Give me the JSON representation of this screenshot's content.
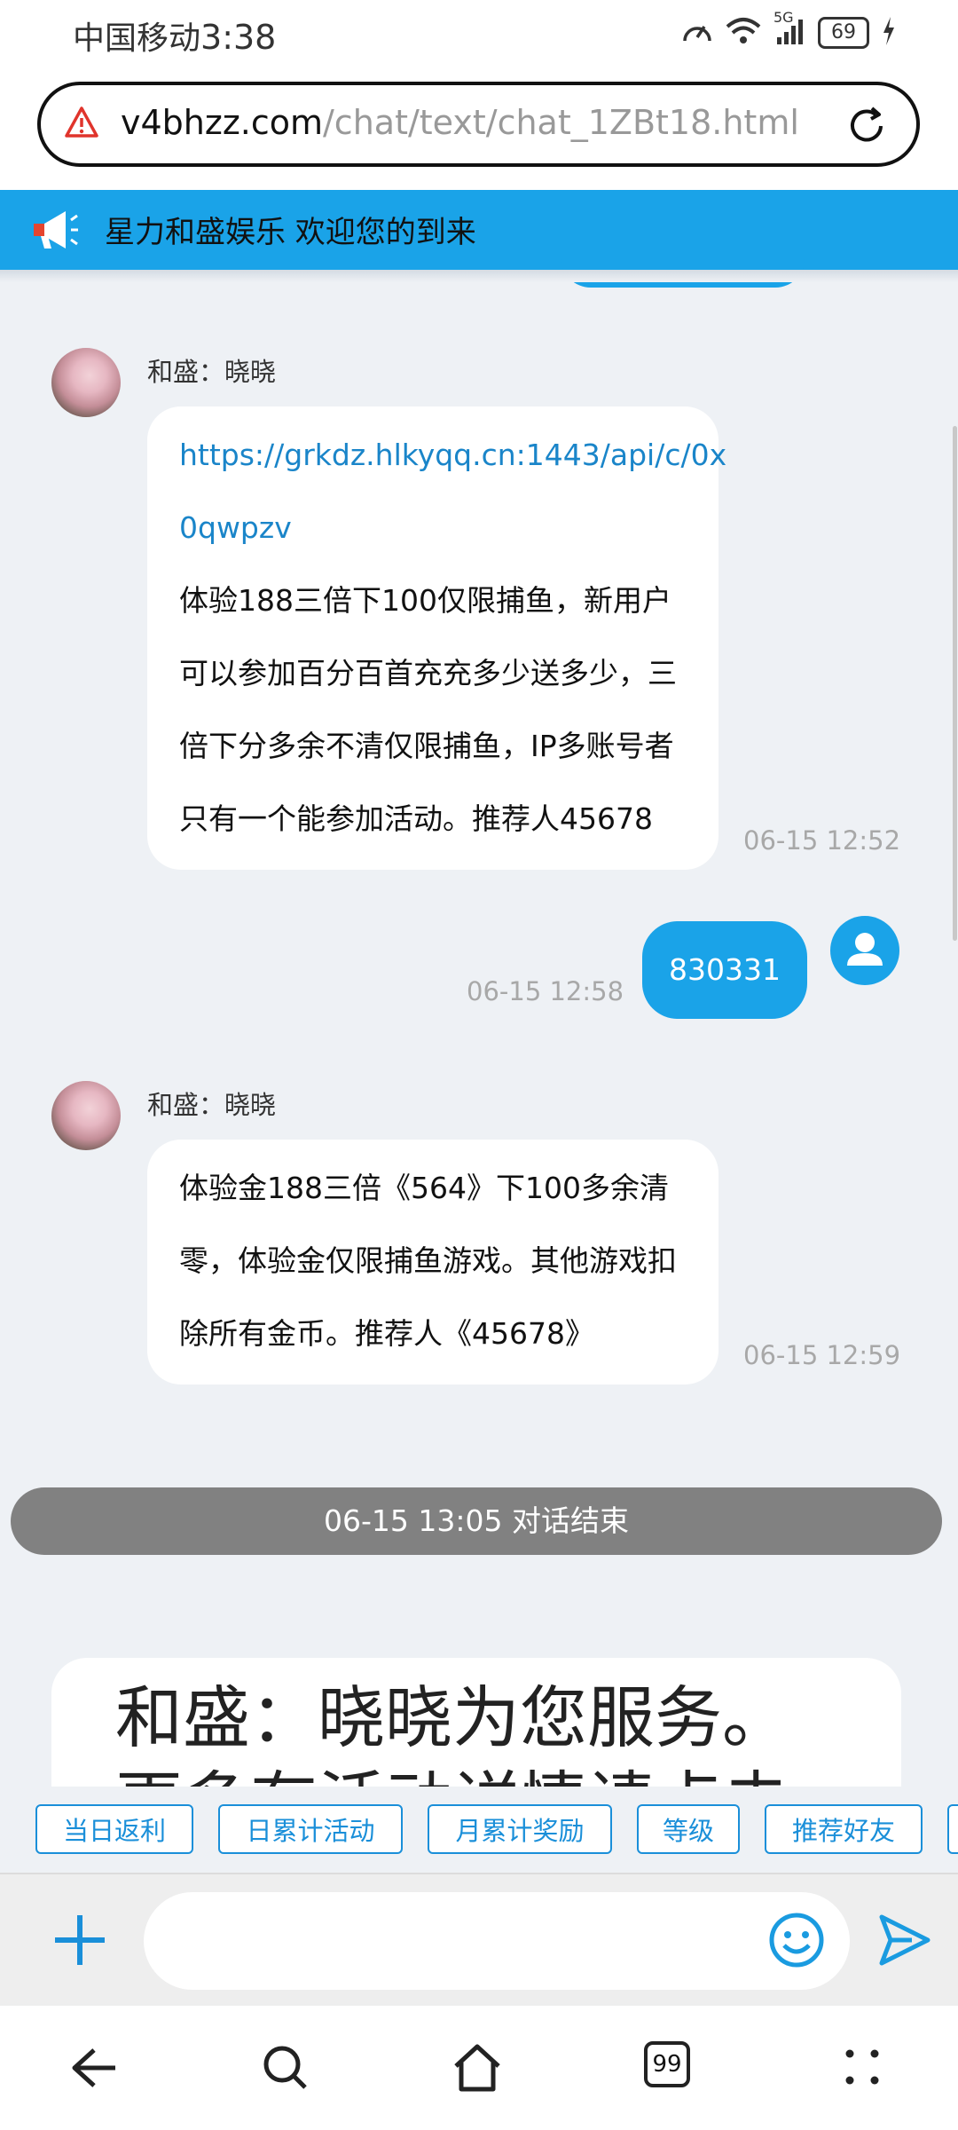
{
  "status_bar": {
    "carrier": "中国移动",
    "time": "3:38",
    "battery": "69",
    "network": "5G"
  },
  "browser": {
    "url_domain": "v4bhzz.com",
    "url_path": "/chat/text/chat_1ZBt18.html"
  },
  "notice": {
    "text": "星力和盛娱乐 欢迎您的到来"
  },
  "messages": [
    {
      "sender": "和盛：晓晓",
      "lines": [
        "https://grkdz.hlkyqq.cn:1443/api/c/0x",
        "0qwpzv",
        "体验188三倍下100仅限捕鱼，新用户",
        "可以参加百分百首充充多少送多少，三",
        "倍下分多余不清仅限捕鱼，IP多账号者",
        "只有一个能参加活动。推荐人45678"
      ],
      "time": "06-15 12:52"
    },
    {
      "text": "830331",
      "time": "06-15 12:58"
    },
    {
      "sender": "和盛：晓晓",
      "lines": [
        "体验金188三倍《564》下100多余清",
        "零，体验金仅限捕鱼游戏。其他游戏扣",
        "除所有金币。推荐人《45678》"
      ],
      "time": "06-15 12:59"
    }
  ],
  "end_banner": "06-15 13:05 对话结束",
  "service_card": {
    "line1": "和盛：晓晓为您服务。",
    "line2": "更多有活动详情请点击"
  },
  "quick_buttons": [
    "当日返利",
    "日累计活动",
    "月累计奖励",
    "等级",
    "推荐好友"
  ],
  "input": {
    "placeholder": ""
  },
  "nav": {
    "tabs_count": "99"
  },
  "colors": {
    "accent": "#1aa3e8",
    "link": "#1a85c9",
    "end_banner": "#818181"
  }
}
